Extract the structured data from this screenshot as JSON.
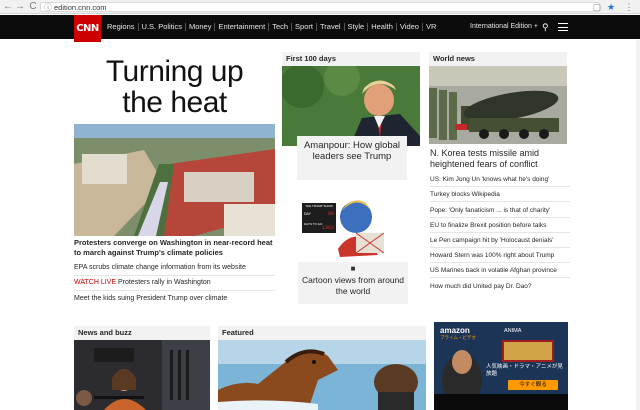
{
  "browser": {
    "url": "edition.cnn.com",
    "back_glyph": "←",
    "forward_glyph": "→",
    "reload_glyph": "C",
    "info_glyph": "ⓘ",
    "menu_glyph": "⋮",
    "star_glyph": "★",
    "ext_glyph": "▢"
  },
  "nav": {
    "logo": "CNN",
    "links": [
      "Regions",
      "U.S. Politics",
      "Money",
      "Entertainment",
      "Tech",
      "Sport",
      "Travel",
      "Style",
      "Health",
      "Video",
      "VR"
    ],
    "edition": "International Edition +",
    "search_glyph": "⚲",
    "brand_color": "#cc0000"
  },
  "lead": {
    "headline_line1": "Turning up",
    "headline_line2": "the heat",
    "title": "Protesters converge on Washington in near-record heat to march against Trump's climate policies",
    "items": [
      {
        "text": "EPA scrubs climate change information from its website"
      },
      {
        "live": "WATCH LIVE",
        "text": " Protesters rally in Washington"
      },
      {
        "text": "Meet the kids suing President Trump over climate"
      }
    ]
  },
  "first100": {
    "header": "First 100 days",
    "title": "Amanpour: How global leaders see Trump",
    "cartoon_title": "Cartoon views from around the world",
    "cartoon_sign": "THE TRUMP SHOW",
    "cartoon_day": "DAY",
    "cartoon_days": "DAYS TO GO",
    "cartoon_num1": "99",
    "cartoon_num2": "1362"
  },
  "world": {
    "header": "World news",
    "title": "N. Korea tests missile amid heightened fears of conflict",
    "items": [
      "US: Kim Jong Un 'knows what he's doing'",
      "Turkey blocks Wikipedia",
      "Pope: 'Only fanaticism ... is that of charity'",
      "EU to finalize Brexit position before talks",
      "Le Pen campaign hit by 'Holocaust denials'",
      "Howard Stern was 100% right about Trump",
      "US Marines back in volatile Afghan province",
      "How much did United pay Dr. Dao?"
    ]
  },
  "bottom": {
    "news_buzz": "News and buzz",
    "featured": "Featured"
  },
  "ad": {
    "brand": "amazon",
    "brand_sub": "プライム・ビデオ",
    "tagline": "ANIMA",
    "jp_text": "人気映画・ドラマ・アニメが見放題",
    "cta": "今すぐ観る"
  }
}
